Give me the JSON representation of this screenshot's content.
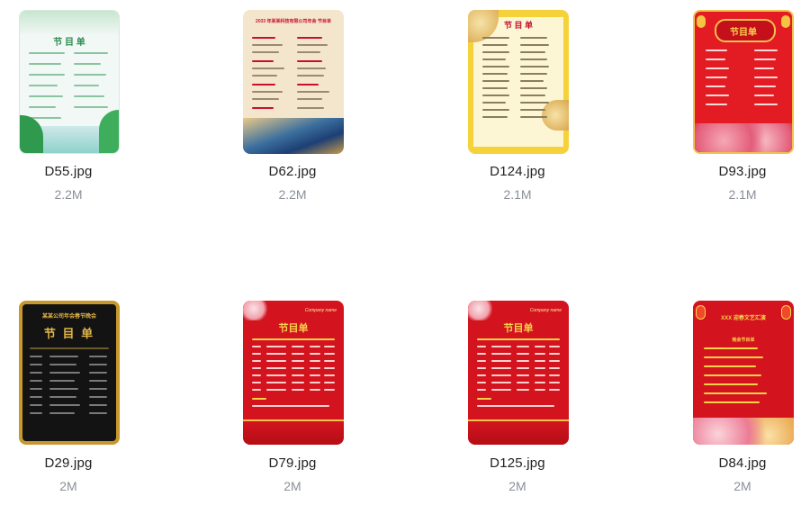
{
  "files": [
    {
      "name": "D55.jpg",
      "size": "2.2M",
      "thumb": {
        "title": "节 目 单",
        "bg": "#eef7f2",
        "accent": "#3aa365"
      }
    },
    {
      "name": "D62.jpg",
      "size": "2.2M",
      "thumb": {
        "title": "2033 年某某科技有限公司年会 节目单",
        "bg": "#f3e3c8",
        "accent": "#c8102e"
      }
    },
    {
      "name": "D124.jpg",
      "size": "2.1M",
      "thumb": {
        "title": "节 目 单",
        "bg": "#fdf4c9",
        "accent": "#e8c020"
      }
    },
    {
      "name": "D93.jpg",
      "size": "2.1M",
      "thumb": {
        "title": "节目单",
        "bg": "#e21c24",
        "accent": "#f7d34a"
      }
    },
    {
      "name": "D29.jpg",
      "size": "2M",
      "thumb": {
        "title": "节 目 单",
        "header": "某某公司年会春节晚会",
        "bg": "#111111",
        "accent": "#d4a52c"
      }
    },
    {
      "name": "D79.jpg",
      "size": "2M",
      "thumb": {
        "title": "节目单",
        "header": "Company name",
        "bg": "#d3141e",
        "accent": "#f7d34a"
      }
    },
    {
      "name": "D125.jpg",
      "size": "2M",
      "thumb": {
        "title": "节目单",
        "header": "Company name",
        "bg": "#d3141e",
        "accent": "#f7d34a"
      }
    },
    {
      "name": "D84.jpg",
      "size": "2M",
      "thumb": {
        "title": "XXX 迎春文艺汇演",
        "subtitle": "晚会节目单",
        "bg": "#d3141e",
        "accent": "#f7d34a"
      }
    }
  ]
}
